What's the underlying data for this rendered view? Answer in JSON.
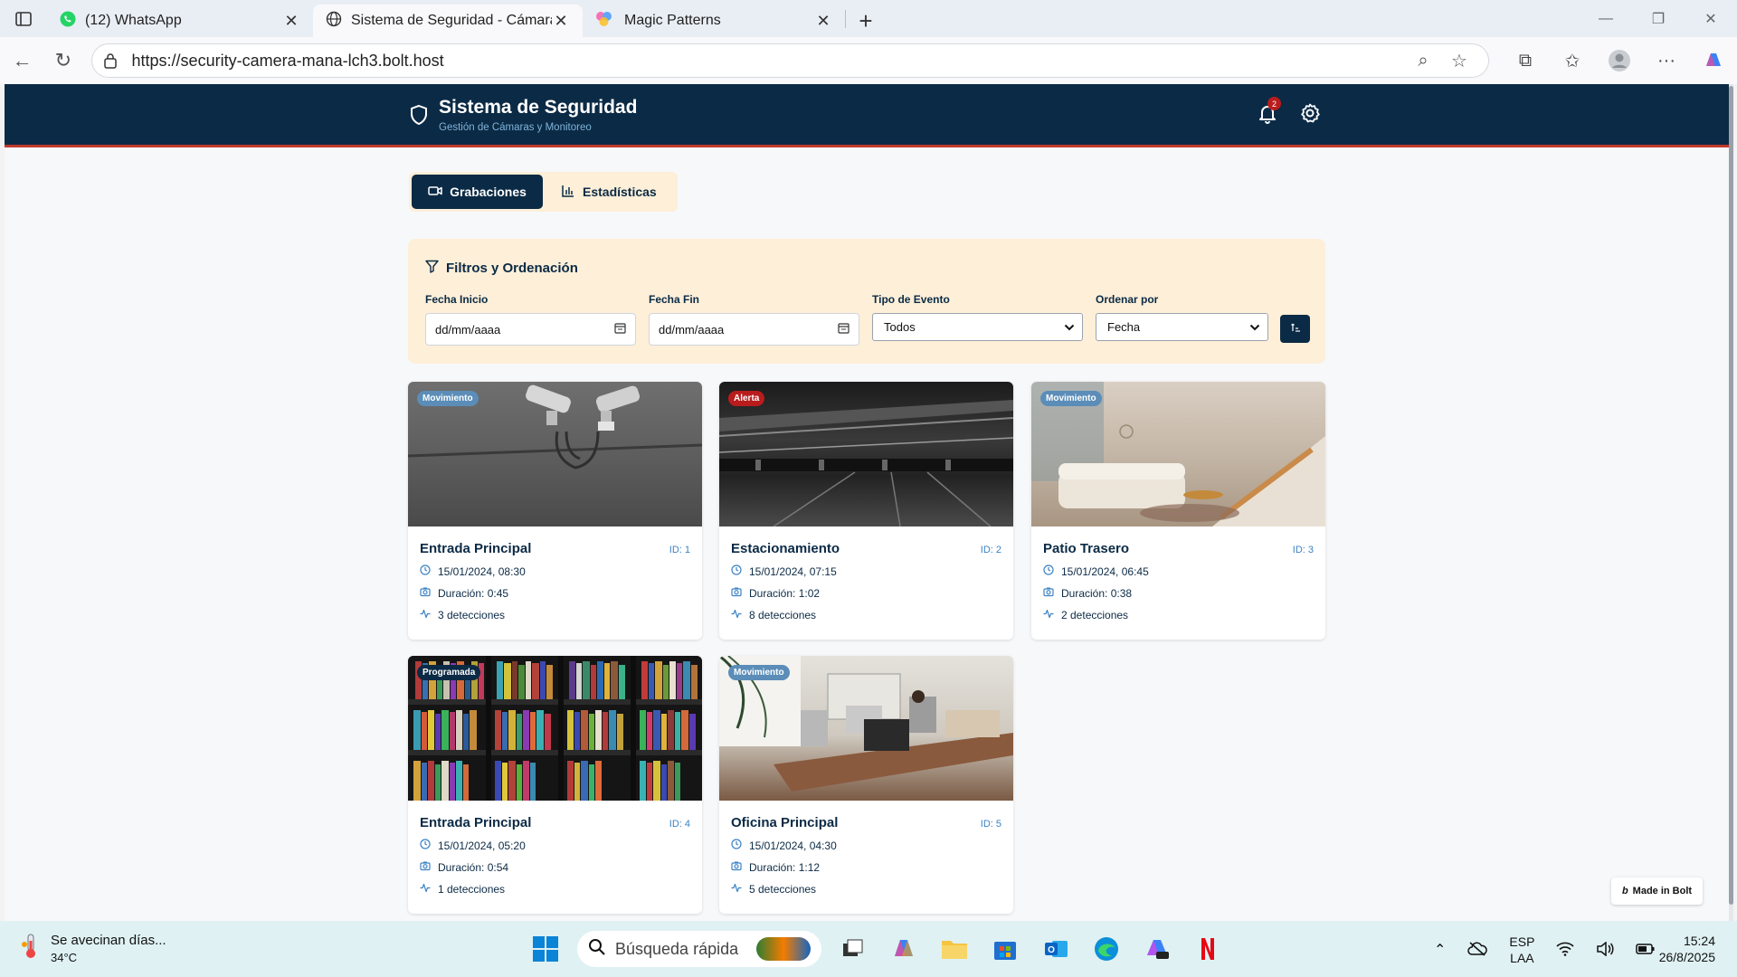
{
  "browser": {
    "tabs": [
      {
        "title": "(12) WhatsApp",
        "icon": "whatsapp-icon"
      },
      {
        "title": "Sistema de Seguridad - Cámaras",
        "icon": "globe-icon"
      },
      {
        "title": "Magic Patterns",
        "icon": "magic-patterns-icon"
      }
    ],
    "url": "https://security-camera-mana-lch3.bolt.host"
  },
  "app": {
    "title": "Sistema de Seguridad",
    "subtitle": "Gestión de Cámaras y Monitoreo",
    "notification_count": "2",
    "tabs": [
      {
        "label": "Grabaciones",
        "active": true
      },
      {
        "label": "Estadísticas",
        "active": false
      }
    ],
    "filters": {
      "title": "Filtros y Ordenación",
      "start_label": "Fecha Inicio",
      "start_value": "dd/mm/aaaa",
      "end_label": "Fecha Fin",
      "end_value": "dd/mm/aaaa",
      "type_label": "Tipo de Evento",
      "type_value": "Todos",
      "order_label": "Ordenar por",
      "order_value": "Fecha"
    },
    "recordings": [
      {
        "badge": "Movimiento",
        "badge_color": "#5b8db8",
        "title": "Entrada Principal",
        "id": "ID: 1",
        "datetime": "15/01/2024, 08:30",
        "duration": "Duración: 0:45",
        "detections": "3 detecciones"
      },
      {
        "badge": "Alerta",
        "badge_color": "#b91c1c",
        "title": "Estacionamiento",
        "id": "ID: 2",
        "datetime": "15/01/2024, 07:15",
        "duration": "Duración: 1:02",
        "detections": "8 detecciones"
      },
      {
        "badge": "Movimiento",
        "badge_color": "#5b8db8",
        "title": "Patio Trasero",
        "id": "ID: 3",
        "datetime": "15/01/2024, 06:45",
        "duration": "Duración: 0:38",
        "detections": "2 detecciones"
      },
      {
        "badge": "Programada",
        "badge_color": "#0b2a45",
        "title": "Entrada Principal",
        "id": "ID: 4",
        "datetime": "15/01/2024, 05:20",
        "duration": "Duración: 0:54",
        "detections": "1 detecciones"
      },
      {
        "badge": "Movimiento",
        "badge_color": "#5b8db8",
        "title": "Oficina Principal",
        "id": "ID: 5",
        "datetime": "15/01/2024, 04:30",
        "duration": "Duración: 1:12",
        "detections": "5 detecciones"
      }
    ],
    "made_in_bolt": "Made in Bolt"
  },
  "taskbar": {
    "weather_text": "Se avecinan días...",
    "temperature": "34°C",
    "search_placeholder": "Búsqueda rápida",
    "lang_1": "ESP",
    "lang_2": "LAA",
    "time": "15:24",
    "date": "26/8/2025"
  }
}
